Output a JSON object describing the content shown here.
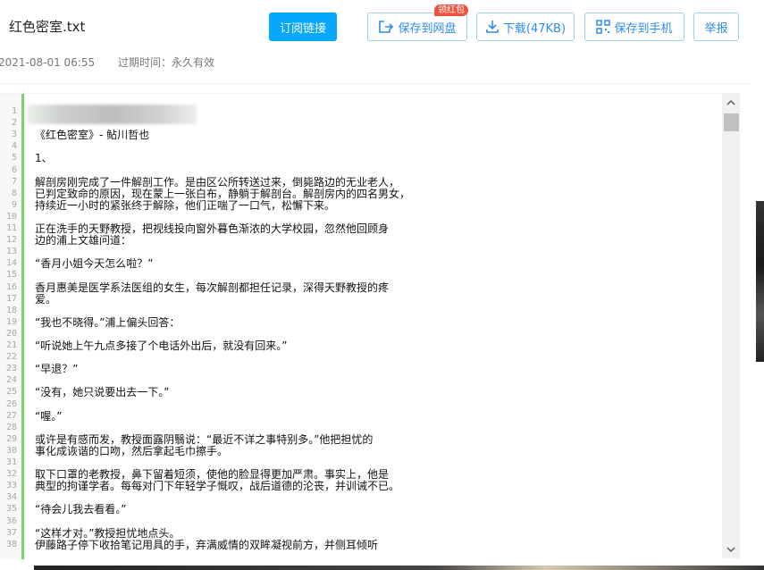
{
  "file": {
    "name": "红色密室.txt",
    "date": "2021-08-01 06:55",
    "expire_label": "过期时间：永久有效"
  },
  "actions": {
    "subscribe": "订阅链接",
    "save_to_disk": "保存到网盘",
    "save_badge": "领红包",
    "download": "下载(47KB)",
    "save_to_phone": "保存到手机",
    "report": "举报"
  },
  "colors": {
    "primary": "#06a7ff",
    "accent_text": "#2d8cf0",
    "badge": "#f0513e",
    "gutter_bar": "#7dd36f"
  },
  "scrollbar": {
    "up_arrow": "^",
    "down_arrow": "v"
  },
  "line_numbers": [
    "1",
    "2",
    "3",
    "4",
    "5",
    "6",
    "7",
    "8",
    "9",
    "10",
    "11",
    "12",
    "13",
    "14",
    "15",
    "16",
    "17",
    "18",
    "19",
    "20",
    "21",
    "22",
    "23",
    "24",
    "25",
    "26",
    "27",
    "28",
    "29",
    "30",
    "31",
    "32",
    "33",
    "34",
    "35",
    "36",
    "37",
    "38"
  ],
  "content_lines": [
    "",
    "",
    "《红色密室》- 鲇川哲也",
    "",
    "    1、",
    "",
    "    解剖房刚完成了一件解剖工作。是由区公所转送过来，倒毙路边的无业老人，",
    "已判定致命的原因，现在蒙上一张白布，静躺于解剖台。解剖房内的四名男女，",
    "持续近一小时的紧张终于解除，他们正喘了一口气，松懈下来。",
    "",
    "    正在洗手的天野教授，把视线投向窗外暮色渐浓的大学校园，忽然他回顾身",
    "边的浦上文雄问道：",
    "",
    "    “香月小姐今天怎么啦？”",
    "",
    "    香月惠美是医学系法医组的女生，每次解剖都担任记录，深得天野教授的疼",
    "爱。",
    "",
    "    “我也不晓得。”浦上偏头回答：",
    "",
    "    “听说她上午九点多接了个电话外出后，就没有回来。”",
    "",
    "    “早退？”",
    "",
    "    “没有，她只说要出去一下。”",
    "",
    "    “喔。”",
    "",
    "    或许是有感而发，教授面露阴翳说：“最近不详之事特别多。”他把担忧的",
    "事化成诙谐的口吻，然后拿起毛巾擦手。",
    "",
    "    取下口罩的老教授，鼻下留着短须，使他的脸显得更加严肃。事实上，他是",
    "典型的拘谨学者。每每对门下年轻学子慨叹，战后道德的沦丧，并训诫不已。",
    "",
    "    “待会儿我去看看。”",
    "",
    "    “这样才对。”教授担忧地点头。",
    "    伊藤路子停下收拾笔记用具的手，弃满威情的双眸凝视前方，并侧耳倾听"
  ]
}
